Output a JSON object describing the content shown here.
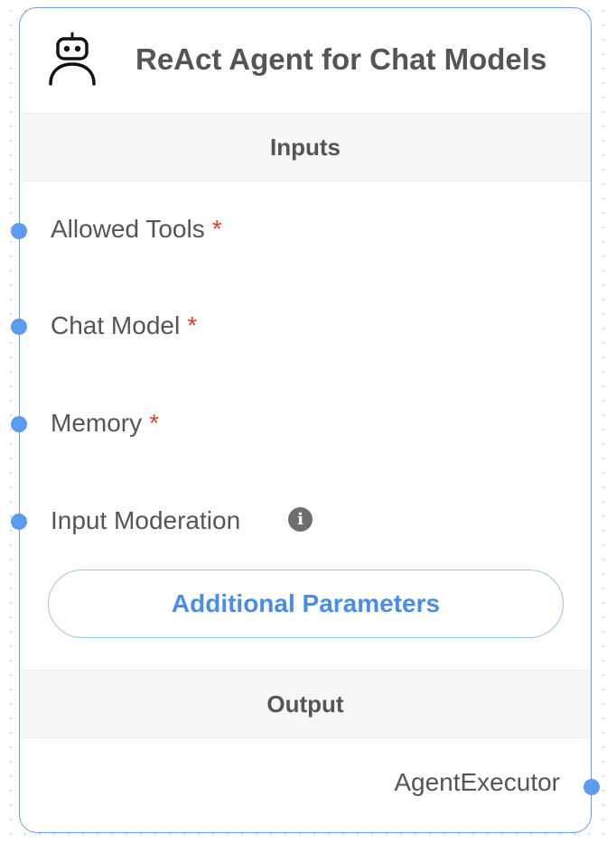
{
  "node": {
    "title": "ReAct Agent for Chat Models",
    "icon": "robot-icon"
  },
  "inputs": {
    "heading": "Inputs",
    "items": [
      {
        "label": "Allowed Tools",
        "required": "*"
      },
      {
        "label": "Chat Model",
        "required": "*"
      },
      {
        "label": "Memory",
        "required": "*"
      },
      {
        "label": "Input Moderation",
        "info_icon": "i"
      }
    ],
    "additional_parameters_label": "Additional Parameters"
  },
  "output": {
    "heading": "Output",
    "items": [
      {
        "label": "AgentExecutor"
      }
    ]
  },
  "colors": {
    "accent": "#5b9cf0",
    "required": "#e0402a",
    "text": "#555555",
    "button_text": "#4a8ce6"
  }
}
